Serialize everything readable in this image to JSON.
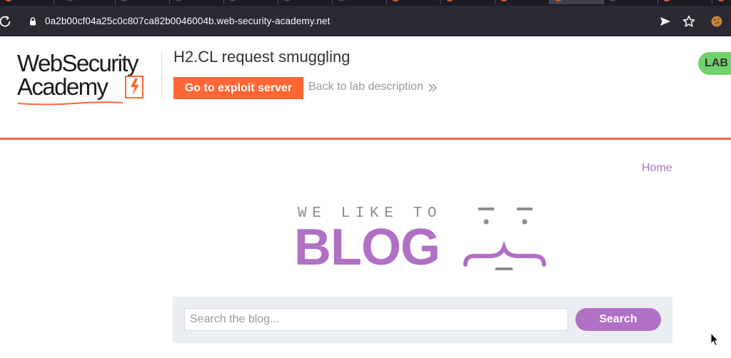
{
  "browser": {
    "url": "0a2b00cf04a25c0c807ca82b0046004b.web-security-academy.net",
    "reload_icon": "reload-icon",
    "lock_icon": "lock-icon",
    "toolbar_icons": [
      "send-icon",
      "star-icon",
      "cookie-icon"
    ]
  },
  "lab_header": {
    "logo_line1": "WebSecurity",
    "logo_line2": "Academy",
    "lab_title": "H2.CL request smuggling",
    "exploit_button": "Go to exploit server",
    "back_link": "Back to lab description",
    "badge": "LAB"
  },
  "blog": {
    "home_link": "Home",
    "banner_top": "WE LIKE TO",
    "banner_main": "BLOG",
    "search_placeholder": "Search the blog...",
    "search_button": "Search"
  },
  "colors": {
    "accent_orange": "#ff6633",
    "accent_purple": "#b070c4",
    "badge_green": "#70d16d",
    "chrome_dark": "#2b2a33"
  }
}
